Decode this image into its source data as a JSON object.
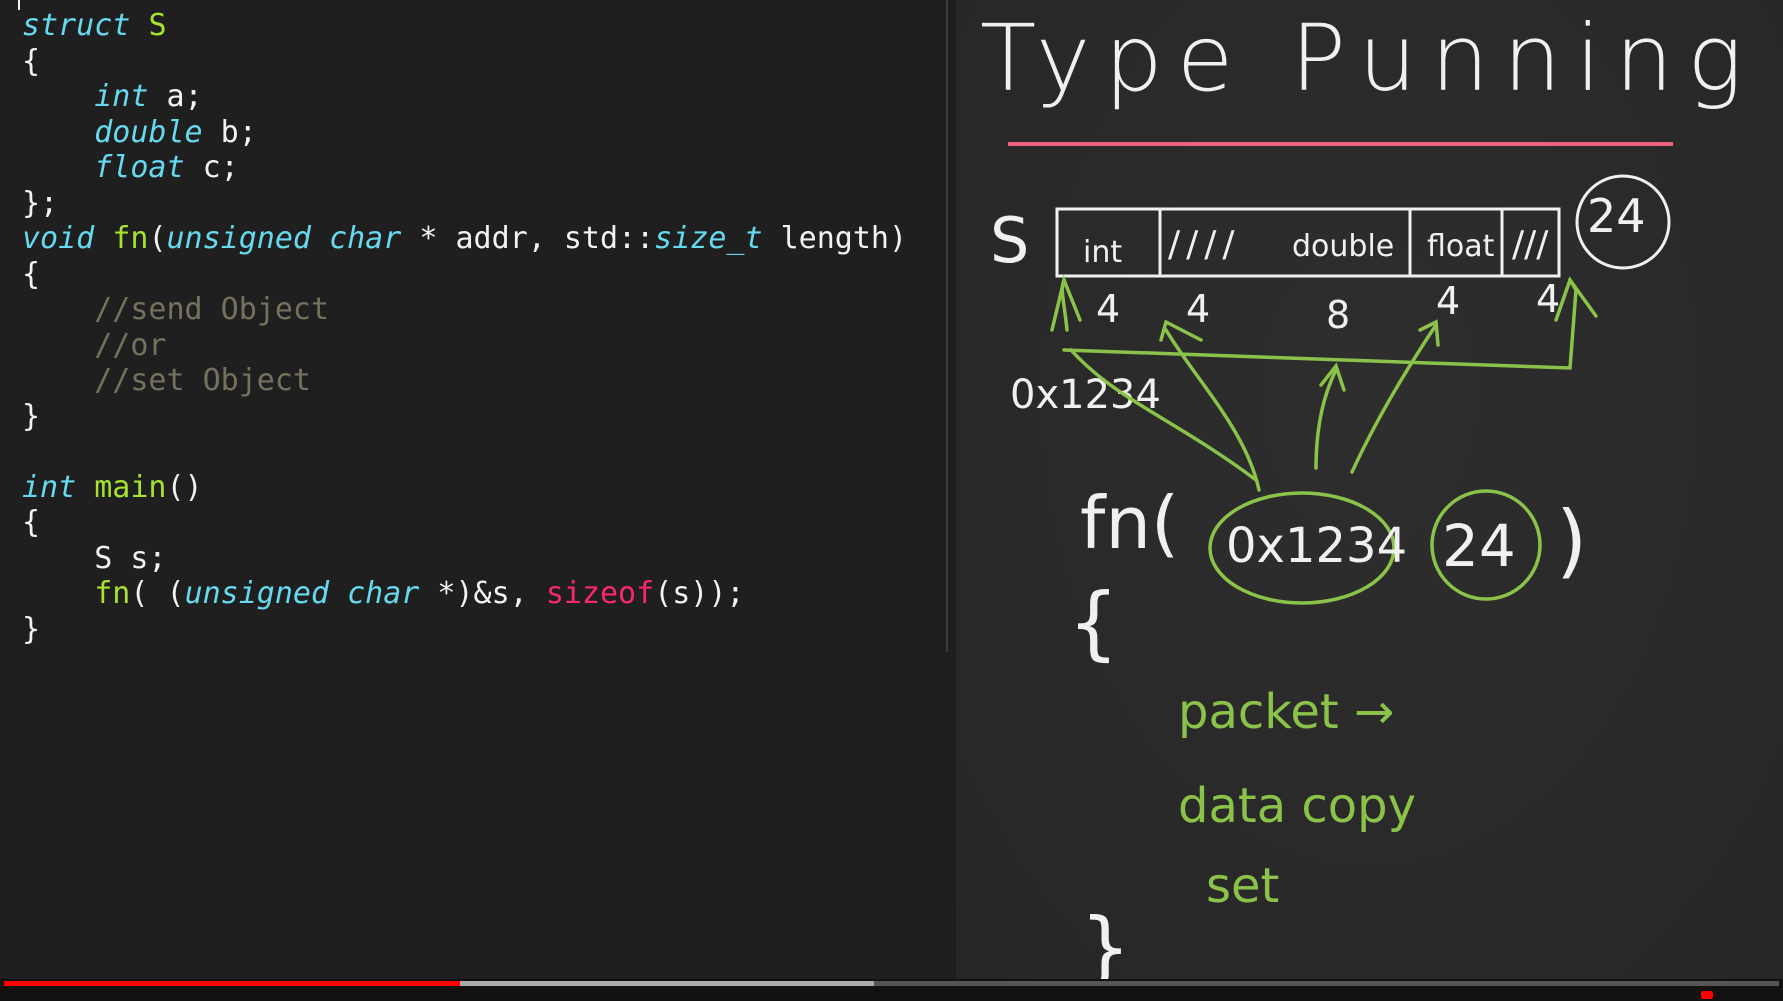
{
  "editor": {
    "lines": [
      [
        {
          "t": "struct",
          "c": "kw"
        },
        {
          "t": " "
        },
        {
          "t": "S",
          "c": "fn"
        }
      ],
      [
        {
          "t": "{"
        }
      ],
      [
        {
          "t": "    "
        },
        {
          "t": "int",
          "c": "kw"
        },
        {
          "t": " a;"
        }
      ],
      [
        {
          "t": "    "
        },
        {
          "t": "double",
          "c": "kw"
        },
        {
          "t": " b;"
        }
      ],
      [
        {
          "t": "    "
        },
        {
          "t": "float",
          "c": "kw"
        },
        {
          "t": " c;"
        }
      ],
      [
        {
          "t": "};"
        }
      ],
      [
        {
          "t": "void",
          "c": "kw"
        },
        {
          "t": " "
        },
        {
          "t": "fn",
          "c": "fn"
        },
        {
          "t": "("
        },
        {
          "t": "unsigned",
          "c": "kw"
        },
        {
          "t": " "
        },
        {
          "t": "char",
          "c": "kw"
        },
        {
          "t": " * addr, std::"
        },
        {
          "t": "size_t",
          "c": "kw"
        },
        {
          "t": " length)"
        }
      ],
      [
        {
          "t": "{"
        }
      ],
      [
        {
          "t": "    "
        },
        {
          "t": "//send Object",
          "c": "cm"
        }
      ],
      [
        {
          "t": "    "
        },
        {
          "t": "//or",
          "c": "cm"
        }
      ],
      [
        {
          "t": "    "
        },
        {
          "t": "//set Object",
          "c": "cm"
        }
      ],
      [
        {
          "t": "}"
        }
      ],
      [
        {
          "t": ""
        }
      ],
      [
        {
          "t": "int",
          "c": "kw"
        },
        {
          "t": " "
        },
        {
          "t": "main",
          "c": "fn"
        },
        {
          "t": "()"
        }
      ],
      [
        {
          "t": "{"
        }
      ],
      [
        {
          "t": "    S s;"
        }
      ],
      [
        {
          "t": "    "
        },
        {
          "t": "fn",
          "c": "fn"
        },
        {
          "t": "( ("
        },
        {
          "t": "unsigned",
          "c": "kw"
        },
        {
          "t": " "
        },
        {
          "t": "char",
          "c": "kw"
        },
        {
          "t": " *)&s, "
        },
        {
          "t": "sizeof",
          "c": "red"
        },
        {
          "t": "(s));"
        }
      ],
      [
        {
          "t": "}"
        }
      ]
    ]
  },
  "board": {
    "title": "Type Punning",
    "struct_name": "S",
    "cells": [
      "int",
      "////",
      "double",
      "float",
      "///"
    ],
    "sizes": [
      "4",
      "4",
      "8",
      "4",
      "4"
    ],
    "total_size": "24",
    "address": "0x1234",
    "call_name": "fn(",
    "call_arg_addr": "0x1234",
    "call_arg_size": "24",
    "call_close": ")",
    "brace_open": "{",
    "brace_close": "}",
    "body_lines": [
      "packet →",
      "data copy",
      "set"
    ],
    "colors": {
      "green": "#8bc34a",
      "white": "#f0f0f0",
      "underline": "#f06080"
    }
  },
  "player": {
    "played_percent": 25.7,
    "buffered_percent": 49
  }
}
